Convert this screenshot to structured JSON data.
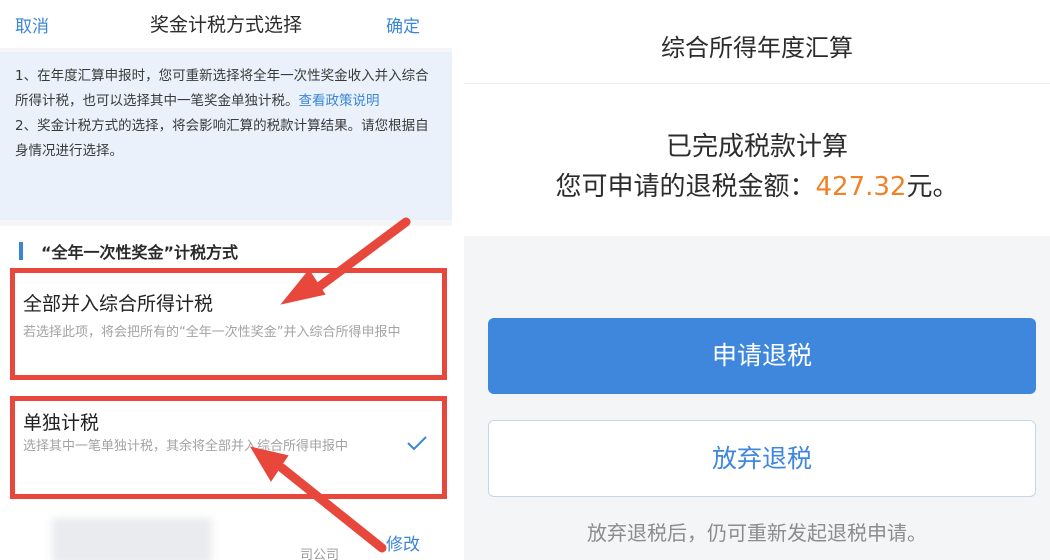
{
  "left": {
    "header": {
      "cancel_label": "取消",
      "title": "奖金计税方式选择",
      "confirm_label": "确定"
    },
    "info": {
      "line1": "1、在年度汇算申报时，您可重新选择将全年一次性奖金收入并入综合所得计税，也可以选择其中一笔奖金单独计税。",
      "policy_link": "查看政策说明",
      "line2": "2、奖金计税方式的选择，将会影响汇算的税款计算结果。请您根据自身情况进行选择。"
    },
    "section": {
      "title": "“全年一次性奖金”计税方式"
    },
    "options": [
      {
        "title": "全部并入综合所得计税",
        "desc": "若选择此项，将会把所有的“全年一次性奖金”并入综合所得申报中",
        "selected": false
      },
      {
        "title": "单独计税",
        "desc": "选择其中一笔单独计税，其余将全部并入综合所得申报中",
        "selected": true
      }
    ],
    "company_suffix": "司公司",
    "edit_label": "修改",
    "annotation_color": "#e8473c"
  },
  "right": {
    "title": "综合所得年度汇算",
    "status": "已完成税款计算",
    "refund_prefix": "您可申请的退税金额：",
    "refund_amount": "427.32",
    "refund_suffix": "元。",
    "apply_button": "申请退税",
    "give_up_button": "放弃退税",
    "note": "放弃退税后，仍可重新发起退税申请。",
    "accent_color": "#3e87dd",
    "amount_color": "#f08226"
  }
}
